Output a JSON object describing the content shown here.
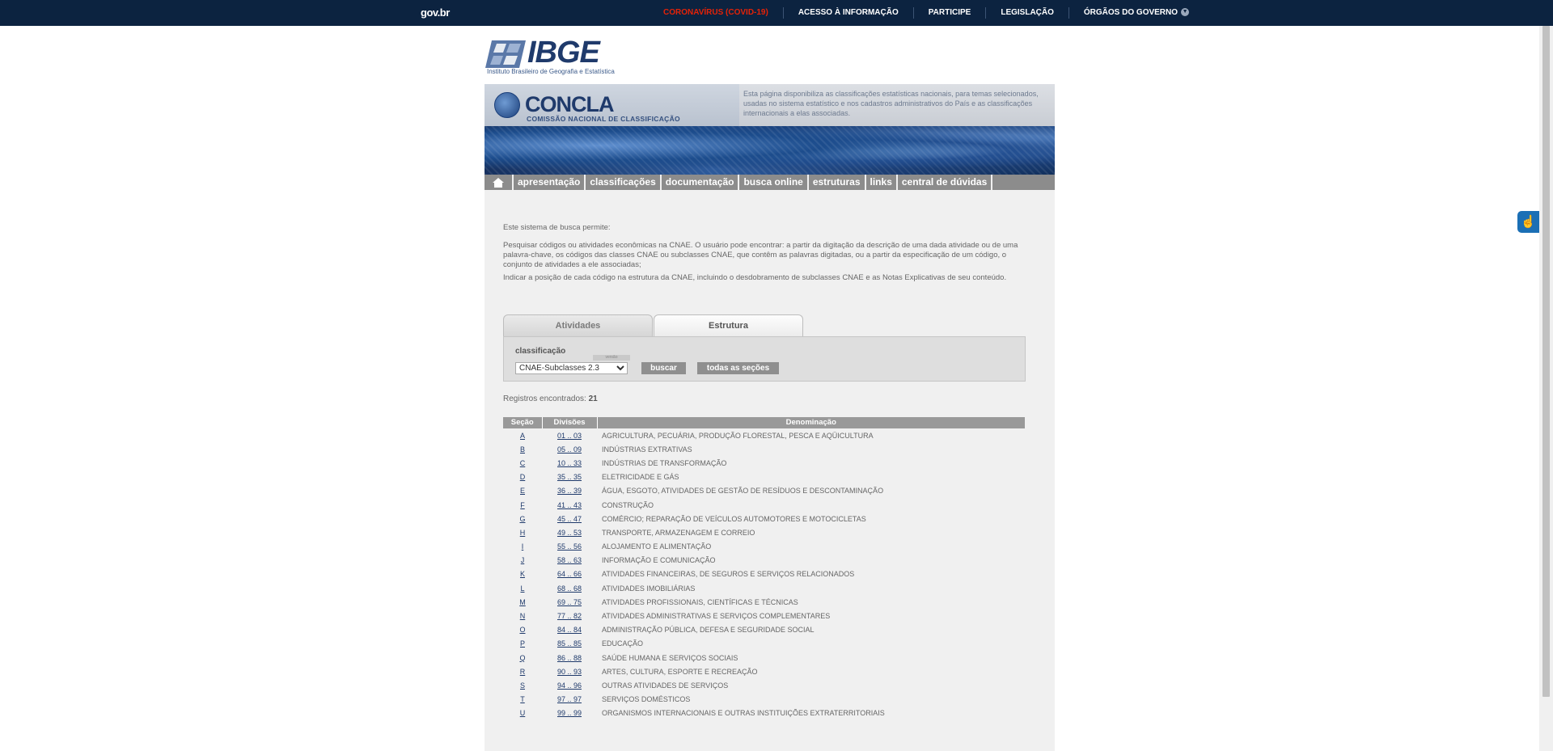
{
  "govbar": {
    "brand": "gov.br",
    "links": [
      "CORONAVÍRUS (COVID-19)",
      "ACESSO À INFORMAÇÃO",
      "PARTICIPE",
      "LEGISLAÇÃO",
      "ÓRGÃOS DO GOVERNO"
    ],
    "colors": {
      "background": "#0c2340",
      "covid": "#e52207"
    }
  },
  "ibge": {
    "name": "IBGE",
    "subtitle": "Instituto Brasileiro de Geografia e Estatística"
  },
  "concla": {
    "title": "CONCLA",
    "subtitle": "COMISSÃO NACIONAL DE CLASSIFICAÇÃO",
    "description": "Esta página disponibiliza as classificações estatísticas nacionais, para temas selecionados, usadas no sistema estatístico e nos cadastros administrativos do País e as classificações internacionais a elas associadas."
  },
  "nav": {
    "home_icon": "home-icon",
    "items": [
      "apresentação",
      "classificações",
      "documentação",
      "busca online",
      "estruturas",
      "links",
      "central de dúvidas"
    ]
  },
  "intro": {
    "p1": "Este sistema de busca permite:",
    "p2": "Pesquisar códigos ou atividades econômicas na CNAE. O usuário pode encontrar: a partir da digitação da descrição de uma dada atividade ou de uma palavra-chave, os códigos das classes CNAE ou subclasses CNAE, que contêm as palavras digitadas, ou a partir da especificação de um código, o conjunto de atividades a ele associadas;",
    "p3": "Indicar a posição de cada código na estrutura da CNAE, incluindo o desdobramento de subclasses CNAE e as Notas Explicativas de seu conteúdo."
  },
  "tabs": {
    "atividades": "Atividades",
    "estrutura": "Estrutura"
  },
  "search": {
    "label": "classificação",
    "version_tag": "versão",
    "selected": "CNAE-Subclasses 2.3",
    "buscar": "buscar",
    "todas": "todas as seções"
  },
  "results": {
    "count_label": "Registros encontrados:",
    "count": "21",
    "headers": {
      "secao": "Seção",
      "divisoes": "Divisões",
      "denominacao": "Denominação"
    },
    "rows": [
      {
        "sec": "A",
        "div": "01 .. 03",
        "den": "AGRICULTURA, PECUÁRIA, PRODUÇÃO FLORESTAL, PESCA E AQÜICULTURA"
      },
      {
        "sec": "B",
        "div": "05 .. 09",
        "den": "INDÚSTRIAS EXTRATIVAS"
      },
      {
        "sec": "C",
        "div": "10 .. 33",
        "den": "INDÚSTRIAS DE TRANSFORMAÇÃO"
      },
      {
        "sec": "D",
        "div": "35 .. 35",
        "den": "ELETRICIDADE E GÁS"
      },
      {
        "sec": "E",
        "div": "36 .. 39",
        "den": "ÁGUA, ESGOTO, ATIVIDADES DE GESTÃO DE RESÍDUOS E DESCONTAMINAÇÃO"
      },
      {
        "sec": "F",
        "div": "41 .. 43",
        "den": "CONSTRUÇÃO"
      },
      {
        "sec": "G",
        "div": "45 .. 47",
        "den": "COMÉRCIO; REPARAÇÃO DE VEÍCULOS AUTOMOTORES E MOTOCICLETAS"
      },
      {
        "sec": "H",
        "div": "49 .. 53",
        "den": "TRANSPORTE, ARMAZENAGEM E CORREIO"
      },
      {
        "sec": "I",
        "div": "55 .. 56",
        "den": "ALOJAMENTO E ALIMENTAÇÃO"
      },
      {
        "sec": "J",
        "div": "58 .. 63",
        "den": "INFORMAÇÃO E COMUNICAÇÃO"
      },
      {
        "sec": "K",
        "div": "64 .. 66",
        "den": "ATIVIDADES FINANCEIRAS, DE SEGUROS E SERVIÇOS RELACIONADOS"
      },
      {
        "sec": "L",
        "div": "68 .. 68",
        "den": "ATIVIDADES IMOBILIÁRIAS"
      },
      {
        "sec": "M",
        "div": "69 .. 75",
        "den": "ATIVIDADES PROFISSIONAIS, CIENTÍFICAS E TÉCNICAS"
      },
      {
        "sec": "N",
        "div": "77 .. 82",
        "den": "ATIVIDADES ADMINISTRATIVAS E SERVIÇOS COMPLEMENTARES"
      },
      {
        "sec": "O",
        "div": "84 .. 84",
        "den": "ADMINISTRAÇÃO PÚBLICA, DEFESA E SEGURIDADE SOCIAL"
      },
      {
        "sec": "P",
        "div": "85 .. 85",
        "den": "EDUCAÇÃO"
      },
      {
        "sec": "Q",
        "div": "86 .. 88",
        "den": "SAÚDE HUMANA E SERVIÇOS SOCIAIS"
      },
      {
        "sec": "R",
        "div": "90 .. 93",
        "den": "ARTES, CULTURA, ESPORTE E RECREAÇÃO"
      },
      {
        "sec": "S",
        "div": "94 .. 96",
        "den": "OUTRAS ATIVIDADES DE SERVIÇOS"
      },
      {
        "sec": "T",
        "div": "97 .. 97",
        "den": "SERVIÇOS DOMÉSTICOS"
      },
      {
        "sec": "U",
        "div": "99 .. 99",
        "den": "ORGANISMOS INTERNACIONAIS E OUTRAS INSTITUIÇÕES EXTRATERRITORIAIS"
      }
    ]
  }
}
